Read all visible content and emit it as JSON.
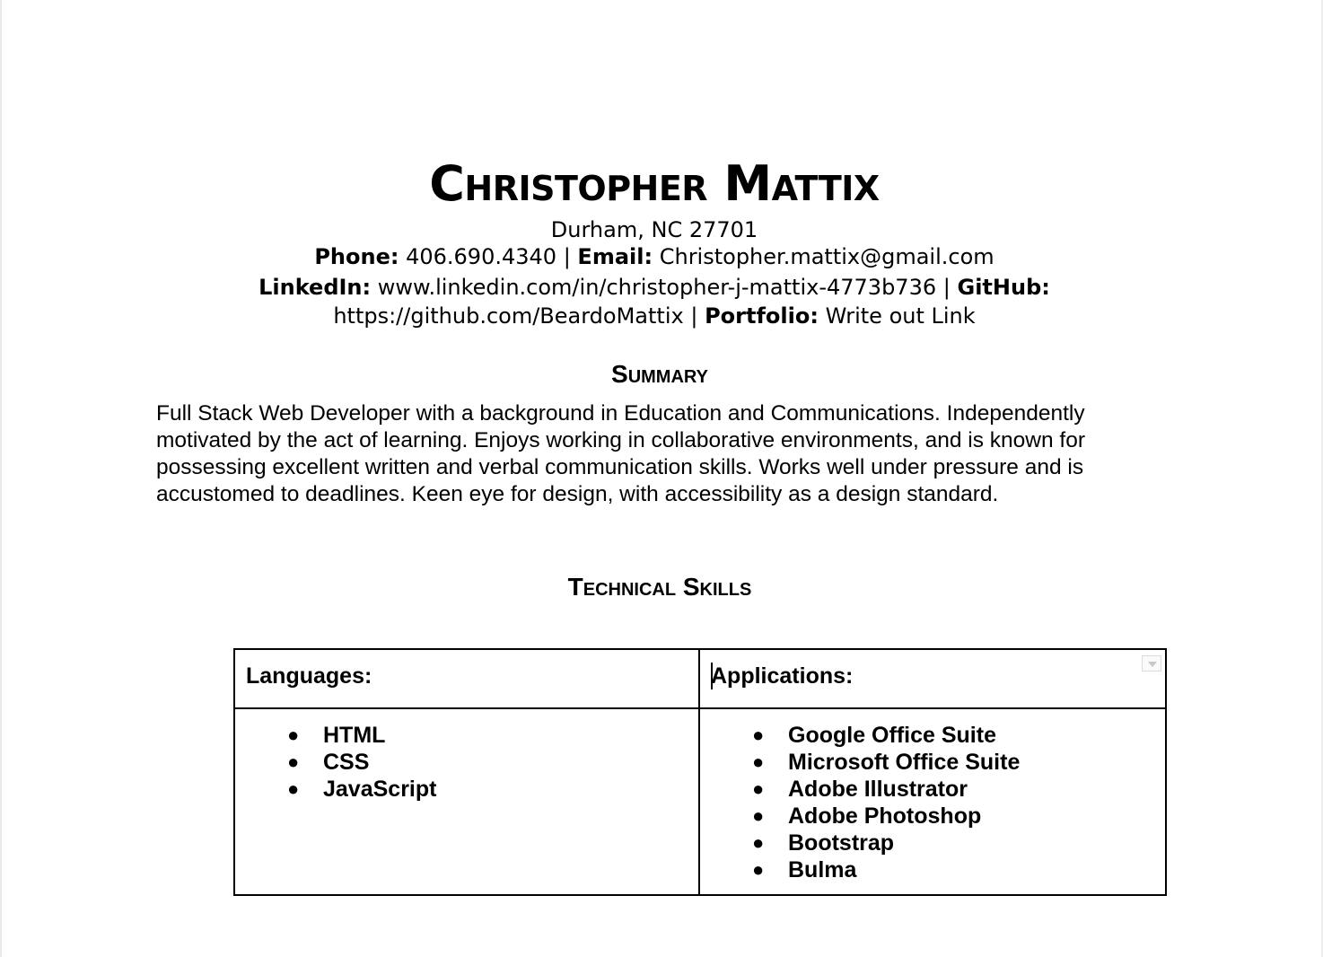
{
  "resume": {
    "name": "Christopher Mattix",
    "contact": {
      "location": "Durham, NC 27701",
      "phone_label": "Phone:",
      "phone": "406.690.4340",
      "email_label": "Email:",
      "email": "Christopher.mattix@gmail.com",
      "linkedin_label": "LinkedIn:",
      "linkedin": "www.linkedin.com/in/christopher-j-mattix-4773b736",
      "github_label": "GitHub:",
      "github": "https://github.com/BeardoMattix",
      "portfolio_label": "Portfolio:",
      "portfolio": "Write out Link",
      "separator": "|"
    },
    "summary": {
      "title": "Summary",
      "text": "Full Stack Web Developer with a background in Education and Communications. Independently motivated by the act of learning. Enjoys working in collaborative environments, and is known for possessing excellent written and verbal communication skills. Works well under pressure and is accustomed to deadlines. Keen eye for design, with accessibility as a design standard."
    },
    "skills": {
      "title": "Technical Skills",
      "languages_label": "Languages:",
      "applications_label": "Applications:",
      "bullet": "●",
      "languages": [
        "HTML",
        "CSS",
        "JavaScript"
      ],
      "applications": [
        "Google Office Suite",
        "Microsoft Office Suite",
        "Adobe Illustrator",
        "Adobe Photoshop",
        "Bootstrap",
        "Bulma"
      ]
    }
  },
  "icons": {
    "table_cell_menu": "dropdown-triangle-icon"
  }
}
